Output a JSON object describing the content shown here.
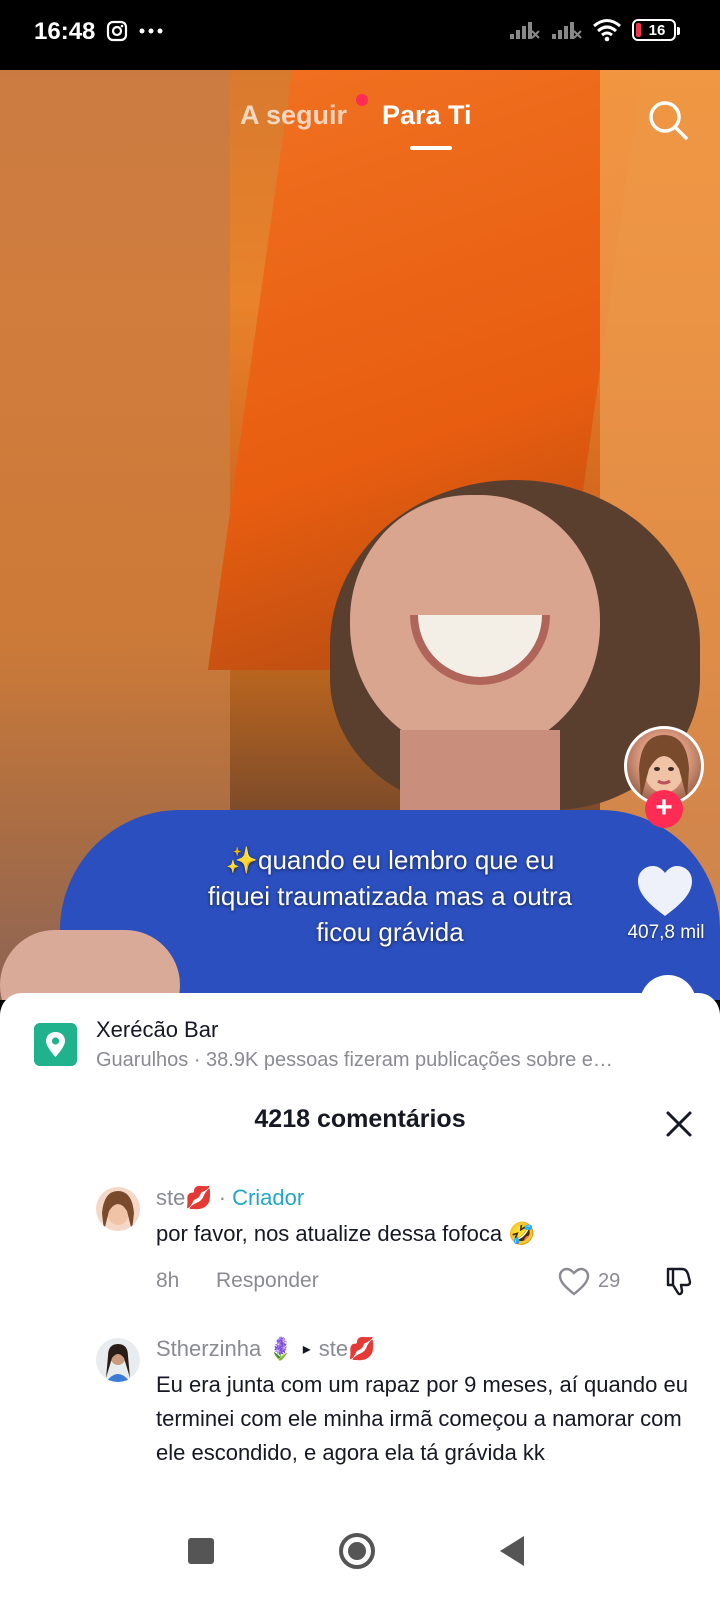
{
  "status_bar": {
    "time": "16:48",
    "icons": [
      "instagram-icon",
      "more-dots-icon",
      "signal-icon",
      "signal-icon",
      "wifi-icon"
    ],
    "battery": "16"
  },
  "top_tabs": {
    "following": "A seguir",
    "for_you": "Para Ti",
    "active": "Para Ti"
  },
  "video": {
    "caption": "✨quando eu lembro que eu fiquei traumatizada mas a outra ficou grávida",
    "like_count": "407,8 mil"
  },
  "location": {
    "title": "Xerécão Bar",
    "subtitle": "Guarulhos · 38.9K pessoas fizeram publicações sobre e…"
  },
  "comments_header": {
    "title": "4218 comentários"
  },
  "comments": [
    {
      "author": "ste💋",
      "separator": "·",
      "badge": "Criador",
      "text": "por favor, nos atualize dessa fofoca 🤣",
      "time": "8h",
      "reply_label": "Responder",
      "likes": "29"
    },
    {
      "author": "Stherzinha 🪻",
      "reply_arrow": "▸",
      "reply_to": "ste💋",
      "text": "Eu era junta com um rapaz por 9 meses, aí quando eu terminei com ele minha irmã começou a namorar com ele escondido, e agora ela tá grávida kk"
    }
  ],
  "colors": {
    "accent_red": "#fe2c55",
    "creator_teal": "#22a7c5",
    "location_green": "#20b28c"
  }
}
